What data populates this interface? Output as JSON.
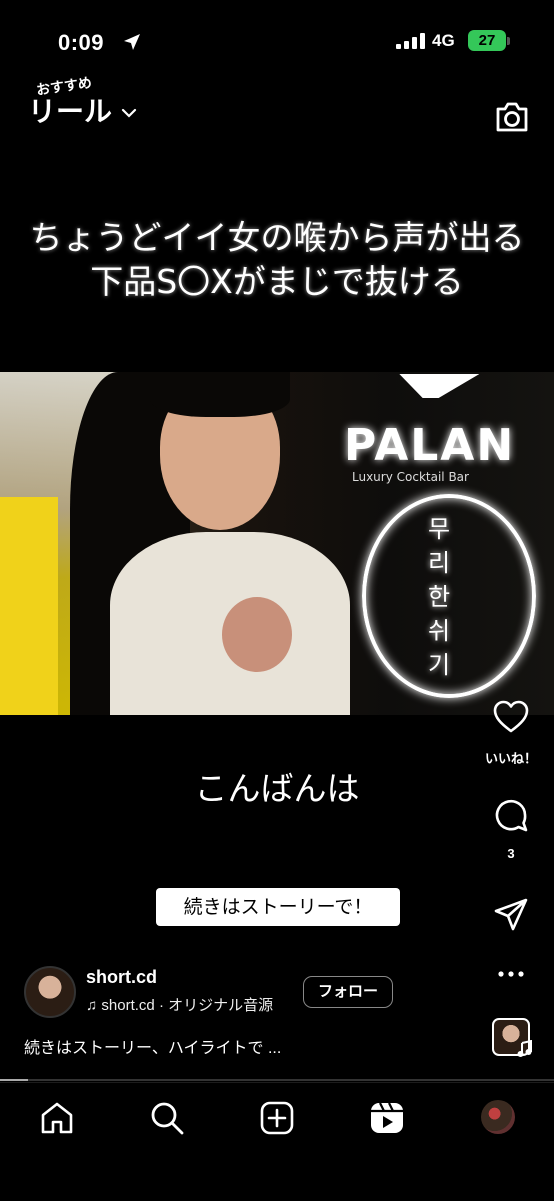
{
  "status_bar": {
    "time": "0:09",
    "network": "4G",
    "battery": "27"
  },
  "header": {
    "title_top": "おすすめ",
    "title": "リール"
  },
  "overlay_caption": {
    "line1": "ちょうどイイ女の喉から声が出る",
    "line2": "下品S〇Xがまじで抜ける"
  },
  "video_scene": {
    "sign_text": "PALAN",
    "sign_sub": "Luxury Cocktail Bar",
    "neon_text": "무리한\n쉬기"
  },
  "subtitle": "こんばんは",
  "actions": {
    "like_label": "いいね！",
    "comment_count": "3"
  },
  "story_button": "続きはストーリーで！",
  "profile": {
    "username": "short.cd",
    "audio": "short.cd · オリジナル音源",
    "follow_label": "フォロー"
  },
  "description": "続きはストーリー、ハイライトで ...",
  "playback": {
    "progress": 0.05
  },
  "icons": {
    "location": "location-arrow-icon",
    "camera": "camera-icon",
    "heart": "heart-icon",
    "comment": "comment-icon",
    "share": "send-icon",
    "more": "more-icon",
    "music": "music-note-icon",
    "home": "home-icon",
    "search": "search-icon",
    "create": "create-icon",
    "reels": "reels-icon"
  },
  "colors": {
    "battery": "#34c759",
    "background": "#000000"
  }
}
